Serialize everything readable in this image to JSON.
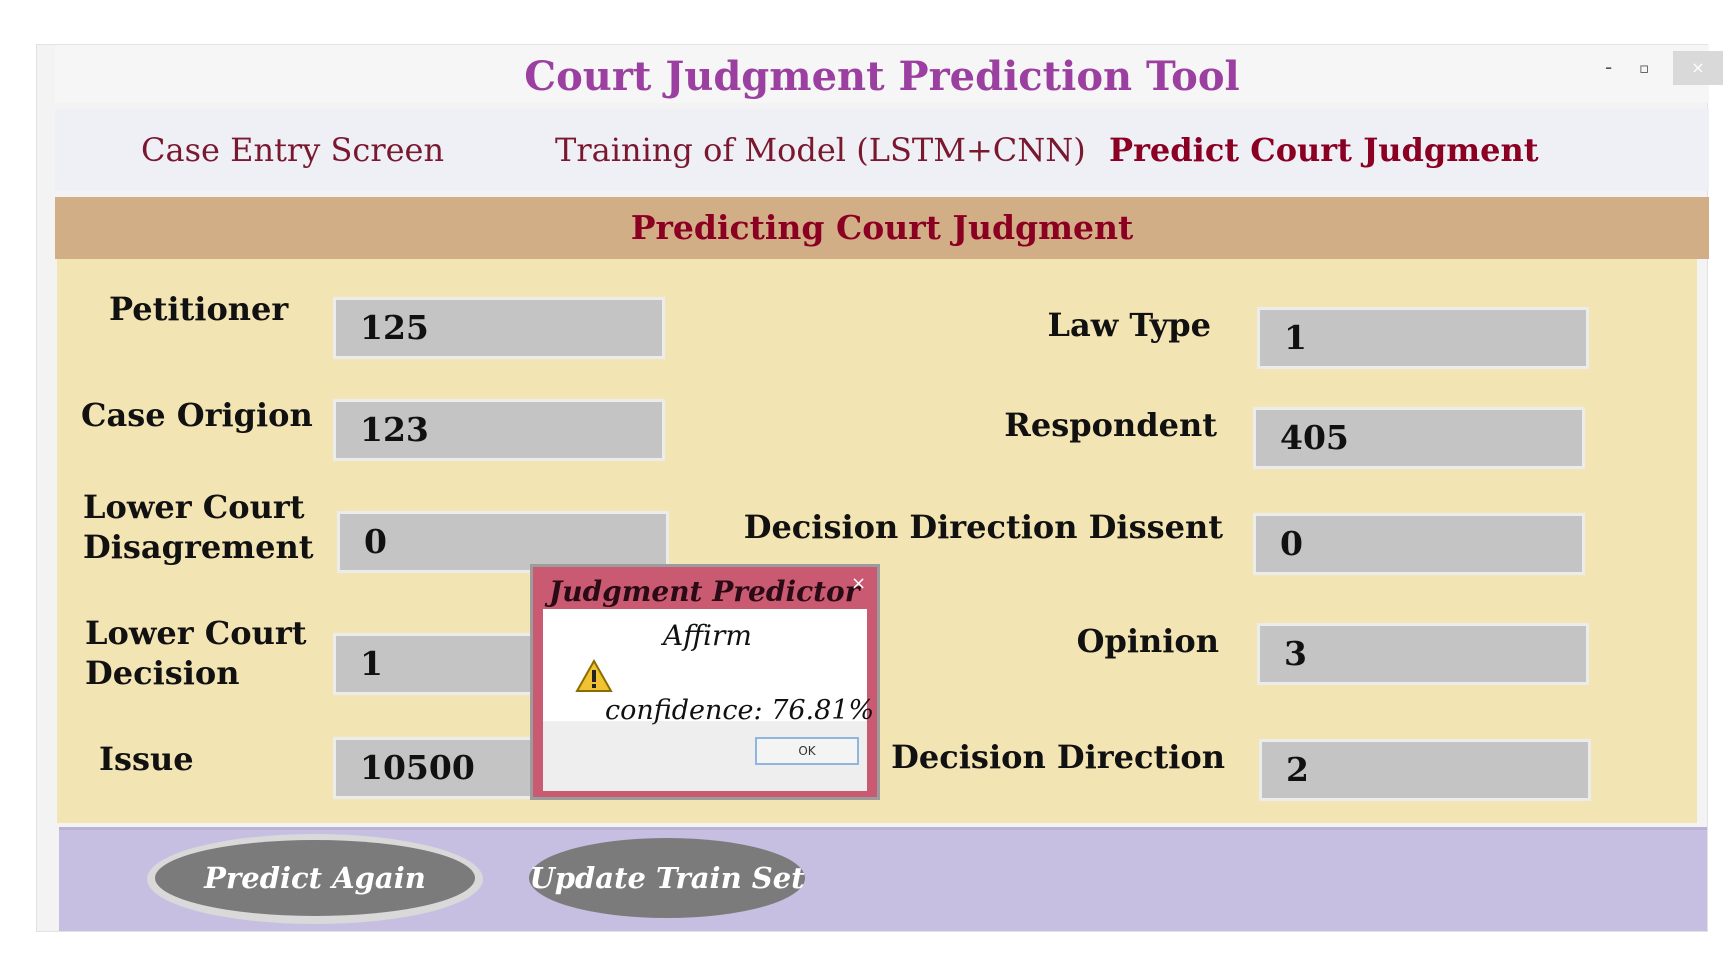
{
  "window": {
    "title": "Court Judgment Prediction Tool",
    "controls": {
      "minimize": "-",
      "maximize": "▫",
      "close": "×"
    }
  },
  "menu": [
    {
      "label": "Case Entry Screen",
      "active": false
    },
    {
      "label": "Training of  Model (LSTM+CNN)",
      "active": false
    },
    {
      "label": "Predict Court Judgment",
      "active": true
    }
  ],
  "section_title": "Predicting Court Judgment",
  "fields": {
    "petitioner": {
      "label": "Petitioner",
      "value": "125"
    },
    "case_origin": {
      "label": "Case Origion",
      "value": "123"
    },
    "lower_court_disagreement": {
      "label_line1": "Lower Court",
      "label_line2": "Disagrement",
      "value": "0"
    },
    "lower_court_decision": {
      "label_line1": "Lower Court",
      "label_line2": "Decision",
      "value": "1"
    },
    "issue": {
      "label": "Issue",
      "value": "10500"
    },
    "law_type": {
      "label": "Law Type",
      "value": "1"
    },
    "respondent": {
      "label": "Respondent",
      "value": "405"
    },
    "decision_direction_dissent": {
      "label": "Decision  Direction Dissent",
      "value": "0"
    },
    "opinion": {
      "label": "Opinion",
      "value": "3"
    },
    "decision_direction": {
      "label": "Decision  Direction",
      "value": "2"
    }
  },
  "buttons": {
    "predict_again": "Predict Again",
    "update_train_set": "Update Train Set"
  },
  "dialog": {
    "title": "Judgment Predictor",
    "close": "×",
    "result": "Affirm",
    "confidence": "confidence: 76.81%",
    "ok": "OK",
    "icon": "warning-icon"
  },
  "colors": {
    "title": "#9b3fa0",
    "menu_active": "#8b0022",
    "header_band": "#d2ae87",
    "form_bg": "#f2e4b3",
    "button_bar": "#c7bfe2",
    "dialog_frame": "#c95a72"
  }
}
